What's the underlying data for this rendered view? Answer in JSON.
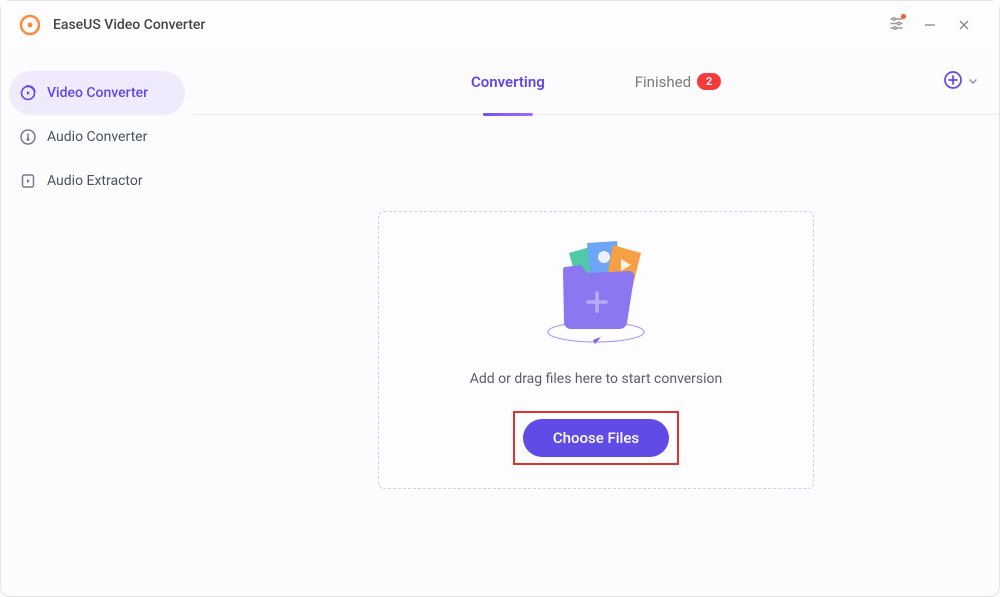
{
  "app": {
    "title": "EaseUS Video Converter"
  },
  "sidebar": {
    "items": [
      {
        "label": "Video Converter",
        "icon": "video-converter-icon",
        "active": true
      },
      {
        "label": "Audio Converter",
        "icon": "audio-converter-icon",
        "active": false
      },
      {
        "label": "Audio Extractor",
        "icon": "audio-extractor-icon",
        "active": false
      }
    ]
  },
  "tabs": {
    "converting": {
      "label": "Converting",
      "active": true
    },
    "finished": {
      "label": "Finished",
      "badge": "2",
      "active": false
    }
  },
  "dropzone": {
    "hint": "Add or drag files here to start conversion",
    "button": "Choose Files"
  },
  "colors": {
    "accent": "#604BE6",
    "accent_light": "#EFEBFD",
    "badge": "#F43A3A",
    "highlight_border": "#E0332B"
  }
}
